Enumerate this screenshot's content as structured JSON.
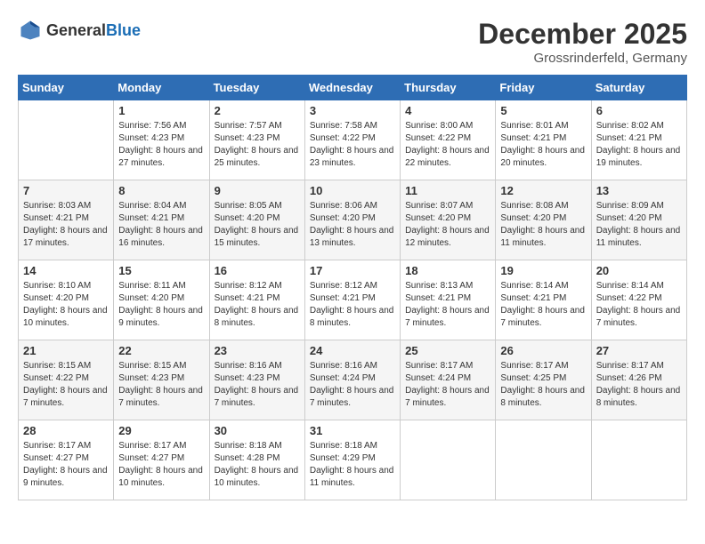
{
  "header": {
    "logo_general": "General",
    "logo_blue": "Blue",
    "month_title": "December 2025",
    "location": "Grossrinderfeld, Germany"
  },
  "days_of_week": [
    "Sunday",
    "Monday",
    "Tuesday",
    "Wednesday",
    "Thursday",
    "Friday",
    "Saturday"
  ],
  "weeks": [
    [
      {
        "day": "",
        "sunrise": "",
        "sunset": "",
        "daylight": ""
      },
      {
        "day": "1",
        "sunrise": "Sunrise: 7:56 AM",
        "sunset": "Sunset: 4:23 PM",
        "daylight": "Daylight: 8 hours and 27 minutes."
      },
      {
        "day": "2",
        "sunrise": "Sunrise: 7:57 AM",
        "sunset": "Sunset: 4:23 PM",
        "daylight": "Daylight: 8 hours and 25 minutes."
      },
      {
        "day": "3",
        "sunrise": "Sunrise: 7:58 AM",
        "sunset": "Sunset: 4:22 PM",
        "daylight": "Daylight: 8 hours and 23 minutes."
      },
      {
        "day": "4",
        "sunrise": "Sunrise: 8:00 AM",
        "sunset": "Sunset: 4:22 PM",
        "daylight": "Daylight: 8 hours and 22 minutes."
      },
      {
        "day": "5",
        "sunrise": "Sunrise: 8:01 AM",
        "sunset": "Sunset: 4:21 PM",
        "daylight": "Daylight: 8 hours and 20 minutes."
      },
      {
        "day": "6",
        "sunrise": "Sunrise: 8:02 AM",
        "sunset": "Sunset: 4:21 PM",
        "daylight": "Daylight: 8 hours and 19 minutes."
      }
    ],
    [
      {
        "day": "7",
        "sunrise": "Sunrise: 8:03 AM",
        "sunset": "Sunset: 4:21 PM",
        "daylight": "Daylight: 8 hours and 17 minutes."
      },
      {
        "day": "8",
        "sunrise": "Sunrise: 8:04 AM",
        "sunset": "Sunset: 4:21 PM",
        "daylight": "Daylight: 8 hours and 16 minutes."
      },
      {
        "day": "9",
        "sunrise": "Sunrise: 8:05 AM",
        "sunset": "Sunset: 4:20 PM",
        "daylight": "Daylight: 8 hours and 15 minutes."
      },
      {
        "day": "10",
        "sunrise": "Sunrise: 8:06 AM",
        "sunset": "Sunset: 4:20 PM",
        "daylight": "Daylight: 8 hours and 13 minutes."
      },
      {
        "day": "11",
        "sunrise": "Sunrise: 8:07 AM",
        "sunset": "Sunset: 4:20 PM",
        "daylight": "Daylight: 8 hours and 12 minutes."
      },
      {
        "day": "12",
        "sunrise": "Sunrise: 8:08 AM",
        "sunset": "Sunset: 4:20 PM",
        "daylight": "Daylight: 8 hours and 11 minutes."
      },
      {
        "day": "13",
        "sunrise": "Sunrise: 8:09 AM",
        "sunset": "Sunset: 4:20 PM",
        "daylight": "Daylight: 8 hours and 11 minutes."
      }
    ],
    [
      {
        "day": "14",
        "sunrise": "Sunrise: 8:10 AM",
        "sunset": "Sunset: 4:20 PM",
        "daylight": "Daylight: 8 hours and 10 minutes."
      },
      {
        "day": "15",
        "sunrise": "Sunrise: 8:11 AM",
        "sunset": "Sunset: 4:20 PM",
        "daylight": "Daylight: 8 hours and 9 minutes."
      },
      {
        "day": "16",
        "sunrise": "Sunrise: 8:12 AM",
        "sunset": "Sunset: 4:21 PM",
        "daylight": "Daylight: 8 hours and 8 minutes."
      },
      {
        "day": "17",
        "sunrise": "Sunrise: 8:12 AM",
        "sunset": "Sunset: 4:21 PM",
        "daylight": "Daylight: 8 hours and 8 minutes."
      },
      {
        "day": "18",
        "sunrise": "Sunrise: 8:13 AM",
        "sunset": "Sunset: 4:21 PM",
        "daylight": "Daylight: 8 hours and 7 minutes."
      },
      {
        "day": "19",
        "sunrise": "Sunrise: 8:14 AM",
        "sunset": "Sunset: 4:21 PM",
        "daylight": "Daylight: 8 hours and 7 minutes."
      },
      {
        "day": "20",
        "sunrise": "Sunrise: 8:14 AM",
        "sunset": "Sunset: 4:22 PM",
        "daylight": "Daylight: 8 hours and 7 minutes."
      }
    ],
    [
      {
        "day": "21",
        "sunrise": "Sunrise: 8:15 AM",
        "sunset": "Sunset: 4:22 PM",
        "daylight": "Daylight: 8 hours and 7 minutes."
      },
      {
        "day": "22",
        "sunrise": "Sunrise: 8:15 AM",
        "sunset": "Sunset: 4:23 PM",
        "daylight": "Daylight: 8 hours and 7 minutes."
      },
      {
        "day": "23",
        "sunrise": "Sunrise: 8:16 AM",
        "sunset": "Sunset: 4:23 PM",
        "daylight": "Daylight: 8 hours and 7 minutes."
      },
      {
        "day": "24",
        "sunrise": "Sunrise: 8:16 AM",
        "sunset": "Sunset: 4:24 PM",
        "daylight": "Daylight: 8 hours and 7 minutes."
      },
      {
        "day": "25",
        "sunrise": "Sunrise: 8:17 AM",
        "sunset": "Sunset: 4:24 PM",
        "daylight": "Daylight: 8 hours and 7 minutes."
      },
      {
        "day": "26",
        "sunrise": "Sunrise: 8:17 AM",
        "sunset": "Sunset: 4:25 PM",
        "daylight": "Daylight: 8 hours and 8 minutes."
      },
      {
        "day": "27",
        "sunrise": "Sunrise: 8:17 AM",
        "sunset": "Sunset: 4:26 PM",
        "daylight": "Daylight: 8 hours and 8 minutes."
      }
    ],
    [
      {
        "day": "28",
        "sunrise": "Sunrise: 8:17 AM",
        "sunset": "Sunset: 4:27 PM",
        "daylight": "Daylight: 8 hours and 9 minutes."
      },
      {
        "day": "29",
        "sunrise": "Sunrise: 8:17 AM",
        "sunset": "Sunset: 4:27 PM",
        "daylight": "Daylight: 8 hours and 10 minutes."
      },
      {
        "day": "30",
        "sunrise": "Sunrise: 8:18 AM",
        "sunset": "Sunset: 4:28 PM",
        "daylight": "Daylight: 8 hours and 10 minutes."
      },
      {
        "day": "31",
        "sunrise": "Sunrise: 8:18 AM",
        "sunset": "Sunset: 4:29 PM",
        "daylight": "Daylight: 8 hours and 11 minutes."
      },
      {
        "day": "",
        "sunrise": "",
        "sunset": "",
        "daylight": ""
      },
      {
        "day": "",
        "sunrise": "",
        "sunset": "",
        "daylight": ""
      },
      {
        "day": "",
        "sunrise": "",
        "sunset": "",
        "daylight": ""
      }
    ]
  ]
}
